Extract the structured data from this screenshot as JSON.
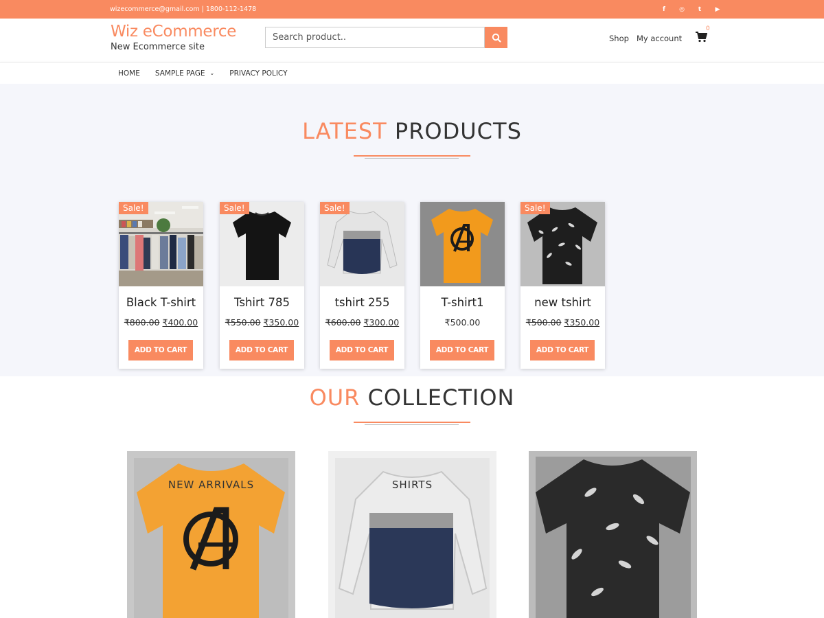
{
  "topbar": {
    "contact": "wizecommerce@gmail.com | 1800-112-1478",
    "social": [
      {
        "icon": "facebook-icon",
        "glyph": "f"
      },
      {
        "icon": "instagram-icon",
        "glyph": "◎"
      },
      {
        "icon": "twitter-icon",
        "glyph": "t"
      },
      {
        "icon": "youtube-icon",
        "glyph": "▶"
      }
    ]
  },
  "brand": {
    "title": "Wiz eCommerce",
    "tagline": "New Ecommerce site"
  },
  "search": {
    "placeholder": "Search product..",
    "button_icon": "search-icon"
  },
  "header_links": {
    "shop": "Shop",
    "account": "My account",
    "cart_count": "0"
  },
  "nav": {
    "home": "HOME",
    "sample": "SAMPLE PAGE",
    "privacy": "PRIVACY POLICY"
  },
  "latest": {
    "title_a": "LATEST",
    "title_b": "PRODUCTS"
  },
  "products": [
    {
      "name": "Black T-shirt",
      "old_price": "₹800.00",
      "price": "₹400.00",
      "sale": "Sale!",
      "button": "ADD TO CART"
    },
    {
      "name": "Tshirt 785",
      "old_price": "₹550.00",
      "price": "₹350.00",
      "sale": "Sale!",
      "button": "ADD TO CART"
    },
    {
      "name": "tshirt 255",
      "old_price": "₹600.00",
      "price": "₹300.00",
      "sale": "Sale!",
      "button": "ADD TO CART"
    },
    {
      "name": "T-shirt1",
      "old_price": "",
      "price": "₹500.00",
      "sale": "",
      "button": "ADD TO CART"
    },
    {
      "name": "new tshirt",
      "old_price": "₹500.00",
      "price": "₹350.00",
      "sale": "Sale!",
      "button": "ADD TO CART"
    }
  ],
  "collection": {
    "title_a": "OUR",
    "title_b": "COLLECTION",
    "items": [
      {
        "label": "NEW ARRIVALS"
      },
      {
        "label": "SHIRTS"
      },
      {
        "label": ""
      }
    ]
  },
  "colors": {
    "accent": "#f98a60",
    "section_bg": "#f5f6fb",
    "text": "#333333"
  }
}
